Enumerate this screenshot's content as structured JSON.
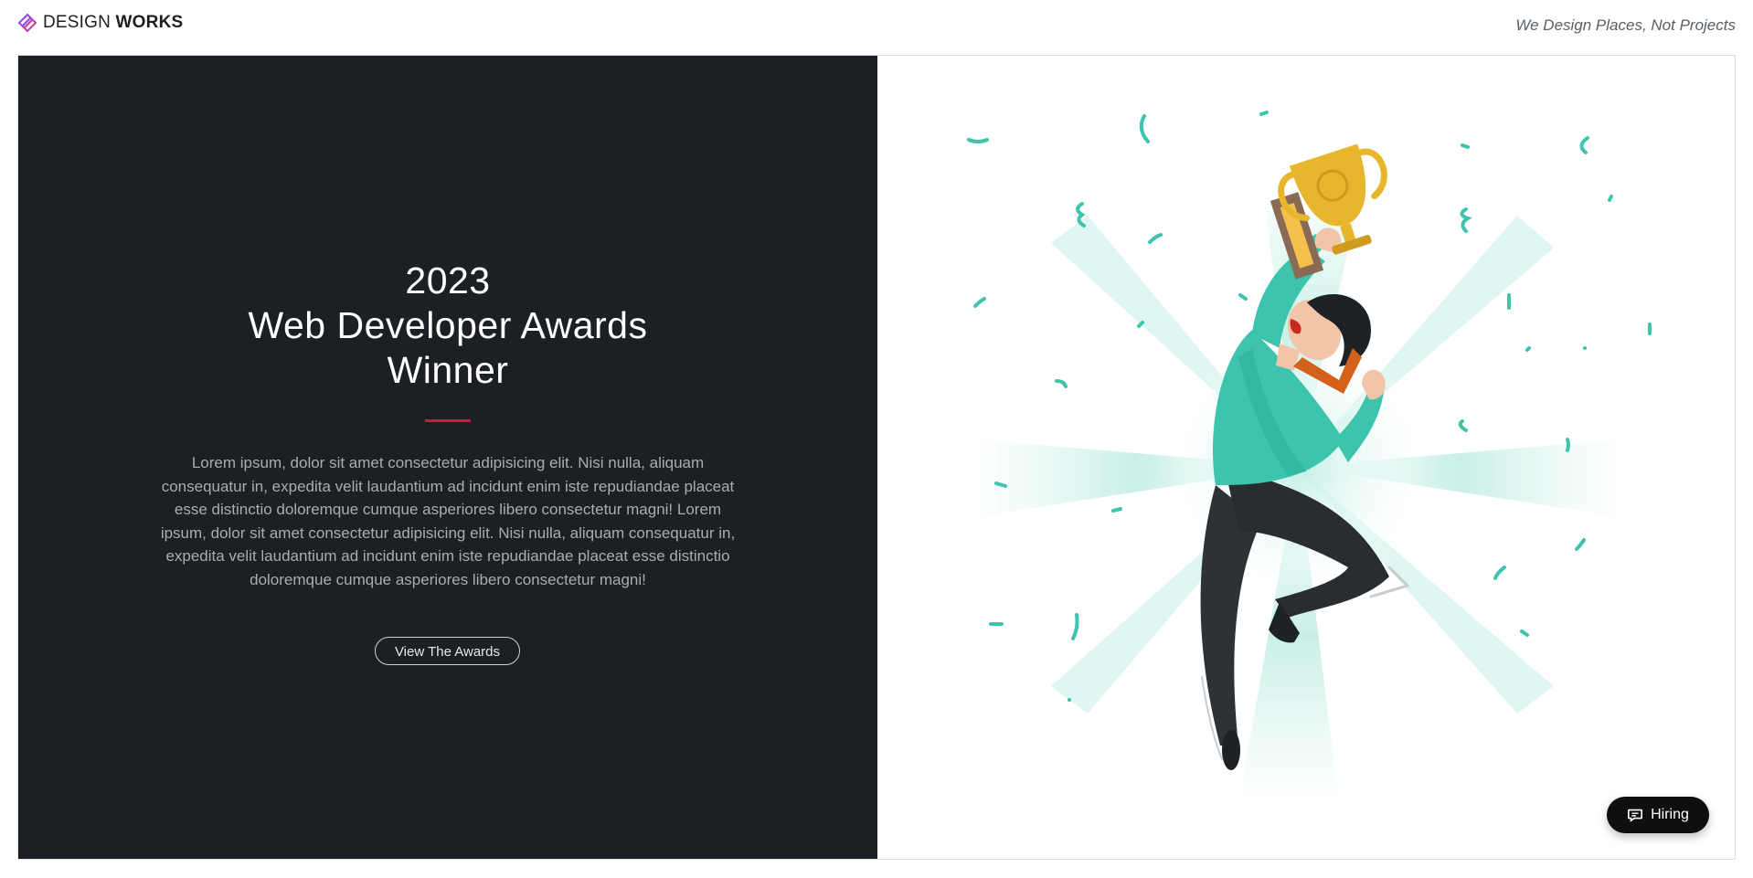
{
  "header": {
    "brand_light": "DESIGN",
    "brand_bold": "WORKS",
    "tagline": "We Design Places, Not Projects",
    "logo_icon": "layered-diamond-logo-icon"
  },
  "hero": {
    "headline": [
      "2023",
      "Web Developer Awards",
      "Winner"
    ],
    "body": "Lorem ipsum, dolor sit amet consectetur adipisicing elit. Nisi nulla, aliquam consequatur in, expedita velit laudantium ad incidunt enim iste repudiandae placeat esse distinctio doloremque cumque asperiores libero consectetur magni! Lorem ipsum, dolor sit amet consectetur adipisicing elit. Nisi nulla, aliquam consequatur in, expedita velit laudantium ad incidunt enim iste repudiandae placeat esse distinctio doloremque cumque asperiores libero consectetur magni!",
    "cta_label": "View The Awards",
    "illustration": "man-jumping-with-trophy-illustration"
  },
  "floating": {
    "hiring_label": "Hiring",
    "hiring_icon": "chat-bubble-icon"
  },
  "colors": {
    "dark_panel": "#1c1f23",
    "accent_red": "#d3173c",
    "teal": "#3cc4ad",
    "gold": "#e8b62c"
  }
}
